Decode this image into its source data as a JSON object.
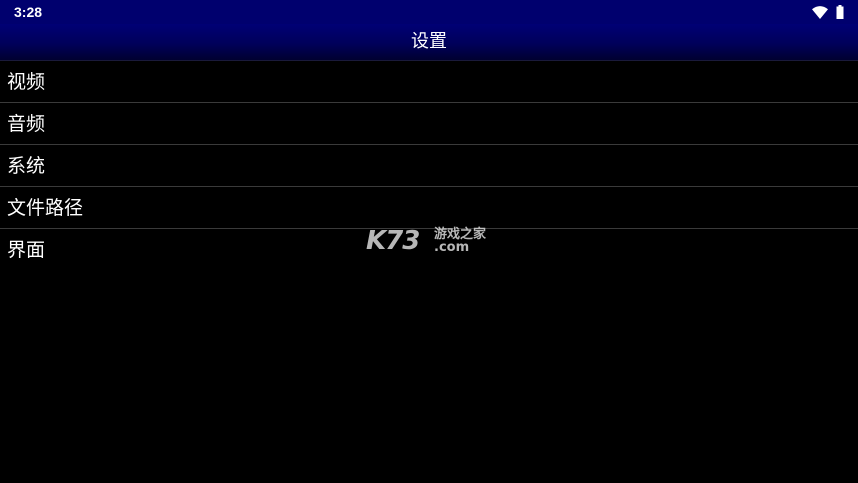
{
  "status_bar": {
    "time": "3:28",
    "icons": [
      "wifi-icon",
      "battery-icon"
    ]
  },
  "header": {
    "title": "设置"
  },
  "menu": {
    "items": [
      {
        "label": "视频"
      },
      {
        "label": "音频"
      },
      {
        "label": "系统"
      },
      {
        "label": "文件路径"
      },
      {
        "label": "界面"
      }
    ]
  },
  "watermark": {
    "logo": "K73",
    "chinese": "游戏之家",
    "domain": ".com"
  },
  "colors": {
    "status_bar": "#00006e",
    "title_bar": "#00005a",
    "background": "#000000",
    "text": "#ffffff",
    "divider": "#3a3a3a"
  }
}
